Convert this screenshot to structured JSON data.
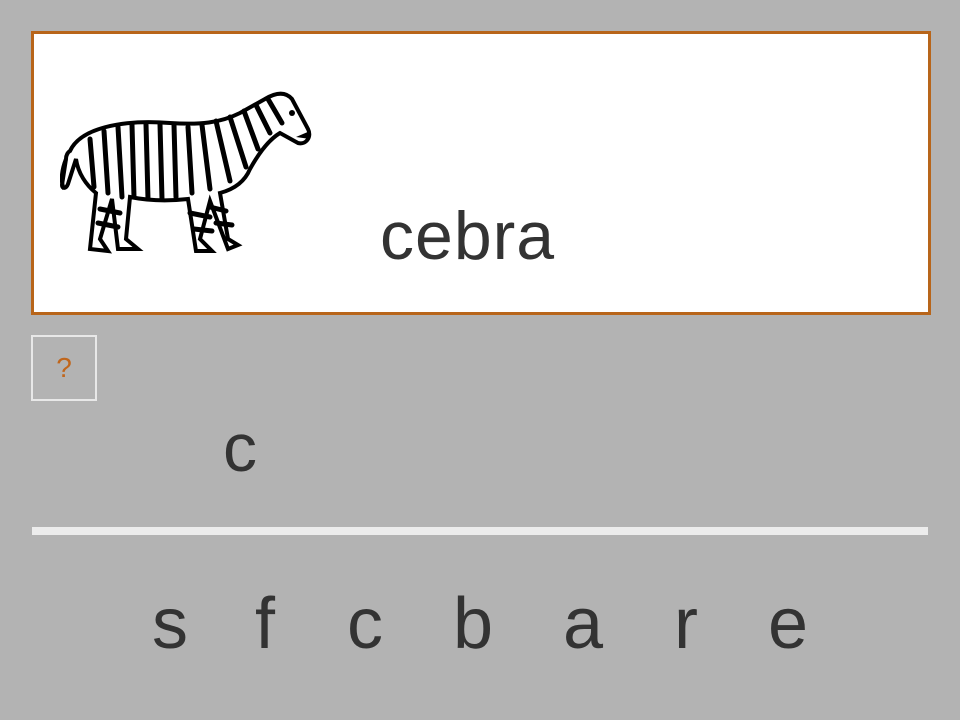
{
  "prompt": {
    "image_icon": "zebra-icon",
    "word": "cebra"
  },
  "hint_button": {
    "label": "?"
  },
  "answer": {
    "typed": "c"
  },
  "letters": [
    "s",
    "f",
    "c",
    "b",
    "a",
    "r",
    "e"
  ],
  "colors": {
    "background": "#b3b3b3",
    "card_border": "#b8651a",
    "hint_text": "#c0661c",
    "text": "#333333"
  }
}
